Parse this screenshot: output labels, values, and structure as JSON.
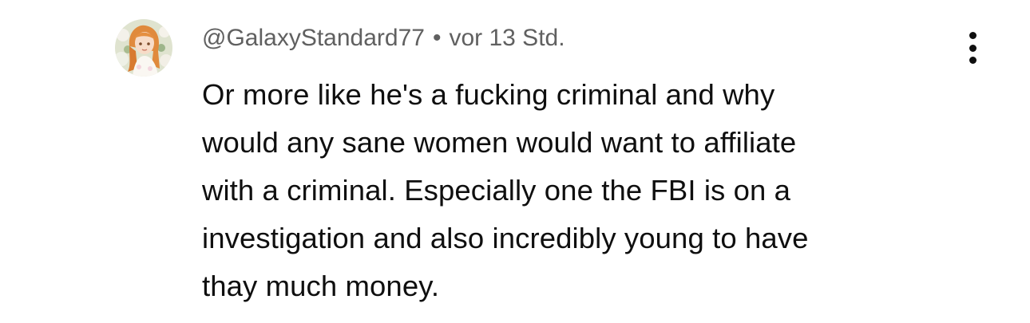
{
  "comment": {
    "avatar_icon": "user-avatar-anime-girl",
    "author": "@GalaxyStandard77",
    "separator": "•",
    "timestamp": "vor 13 Std.",
    "text_lines": [
      "Or more like he's a fucking criminal and why",
      "would any sane women would want to affiliate",
      "with a criminal. Especially one the FBI is on a",
      "investigation and also incredibly young to have",
      "thay much money."
    ],
    "menu_icon": "more-vertical-icon"
  },
  "colors": {
    "text_primary": "#0f0f0f",
    "text_secondary": "#606060",
    "background": "#ffffff"
  }
}
